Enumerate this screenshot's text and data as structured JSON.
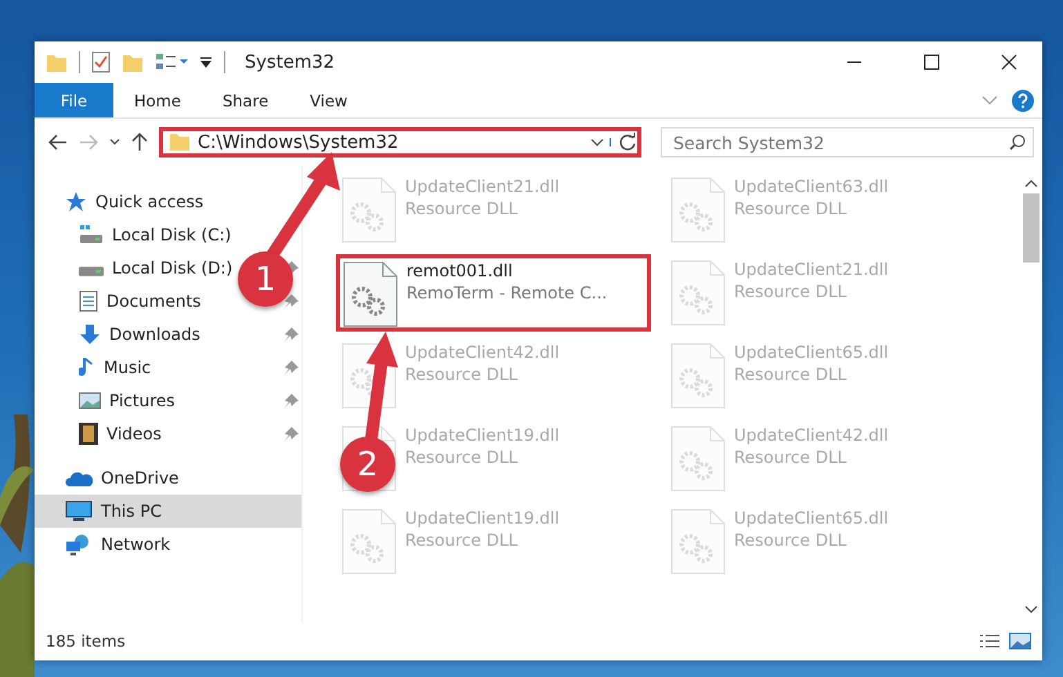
{
  "window": {
    "title": "System32"
  },
  "ribbon": {
    "tabs": [
      {
        "label": "File",
        "kind": "file",
        "selected": false
      },
      {
        "label": "Home",
        "kind": "tab",
        "selected": false
      },
      {
        "label": "Share",
        "kind": "tab",
        "selected": false
      },
      {
        "label": "View",
        "kind": "tab",
        "selected": false
      }
    ]
  },
  "address_bar": {
    "value": "C:\\Windows\\System32",
    "highlighted": true
  },
  "search": {
    "placeholder": "Search System32"
  },
  "sidebar": {
    "items": [
      {
        "label": "Quick access",
        "kind": "star",
        "selected": false,
        "children": [
          {
            "label": "Local Disk (C:)",
            "kind": "drive-c",
            "pinned": false,
            "selected": false
          },
          {
            "label": "Local Disk (D:)",
            "kind": "drive",
            "pinned": true,
            "selected": false
          },
          {
            "label": "Documents",
            "kind": "documents",
            "pinned": true,
            "selected": false
          },
          {
            "label": "Downloads",
            "kind": "downloads",
            "pinned": true,
            "selected": false
          },
          {
            "label": "Music",
            "kind": "music",
            "pinned": true,
            "selected": false
          },
          {
            "label": "Pictures",
            "kind": "pictures",
            "pinned": true,
            "selected": false
          },
          {
            "label": "Videos",
            "kind": "videos",
            "pinned": true,
            "selected": false
          }
        ]
      },
      {
        "label": "OneDrive",
        "kind": "cloud",
        "selected": false
      },
      {
        "label": "This PC",
        "kind": "pc",
        "selected": true
      },
      {
        "label": "Network",
        "kind": "network",
        "selected": false
      }
    ]
  },
  "files": [
    {
      "name": "UpdateClient21.dll",
      "description": "Resource DLL",
      "faded": true,
      "highlighted": false
    },
    {
      "name": "UpdateClient63.dll",
      "description": "Resource DLL",
      "faded": true,
      "highlighted": false
    },
    {
      "name": "remot001.dll",
      "description": "RemoTerm - Remote C...",
      "faded": false,
      "highlighted": true
    },
    {
      "name": "UpdateClient21.dll",
      "description": "Resource DLL",
      "faded": true,
      "highlighted": false
    },
    {
      "name": "UpdateClient42.dll",
      "description": "Resource DLL",
      "faded": true,
      "highlighted": false
    },
    {
      "name": "UpdateClient65.dll",
      "description": "Resource DLL",
      "faded": true,
      "highlighted": false
    },
    {
      "name": "UpdateClient19.dll",
      "description": "Resource DLL",
      "faded": true,
      "highlighted": false
    },
    {
      "name": "UpdateClient42.dll",
      "description": "Resource DLL",
      "faded": true,
      "highlighted": false
    },
    {
      "name": "UpdateClient19.dll",
      "description": "Resource DLL",
      "faded": true,
      "highlighted": false
    },
    {
      "name": "UpdateClient65.dll",
      "description": "Resource DLL",
      "faded": true,
      "highlighted": false
    }
  ],
  "status_bar": {
    "item_count": "185 items"
  },
  "annotations": [
    {
      "number": "1"
    },
    {
      "number": "2"
    }
  ]
}
